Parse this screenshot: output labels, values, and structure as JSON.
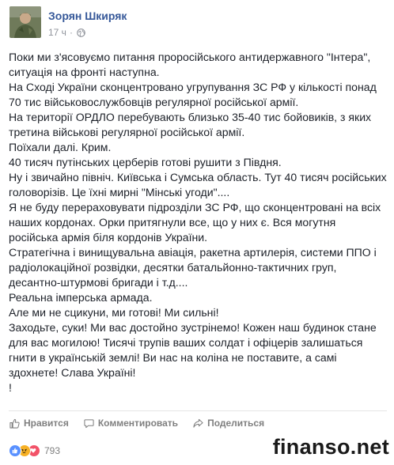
{
  "post": {
    "author": "Зорян Шкиряк",
    "time": "17 ч",
    "separator": "·",
    "paragraphs": [
      "Поки ми з'ясовуємо питання проросійського антидержавного \"Інтера\", ситуація на фронті наступна.",
      "На Сході України сконцентровано угрупування ЗС РФ у кількості понад 70 тис військовослужбовців регулярної російської армії.",
      "На території ОРДЛО перебувають близько 35-40 тис бойовиків, з яких третина військові регулярної російської армії.",
      "Поїхали далі. Крим.",
      "40 тисяч путінських церберів готові рушити з Півдня.",
      "Ну і звичайно північ. Київська і Сумська область. Тут 40 тисяч російських головорізів. Це їхні мирні \"Мінські угоди\"....",
      "Я не буду перераховувати підрозділи ЗС РФ, що сконцентровані на всіх наших кордонах. Орки притягнули все, що у них є. Вся могутня російська армія біля кордонів України.",
      "Стратегічна і винищувальна авіація, ракетна артилерія, системи ППО і радіолокаційної розвідки, десятки батальйонно-тактичних груп, десантно-штурмові бригади і т.д....",
      "Реальна імперська армада.",
      "Але ми не сцикуни, ми готові! Ми сильні!",
      "Заходьте, суки! Ми вас достойно зустрінемо! Кожен наш будинок стане для вас могилою! Тисячі трупів ваших солдат і офіцерів залишаться гнити в українській землі! Ви нас на коліна не поставите, а самі здохнете! Слава Україні!",
      "!"
    ]
  },
  "actions": {
    "like_label": "Нравится",
    "comment_label": "Комментировать",
    "share_label": "Поделиться"
  },
  "reactions": {
    "count": "793",
    "types": [
      "like",
      "angry",
      "love"
    ]
  },
  "watermark": "finanso.net",
  "icons": {
    "globe": "globe-icon",
    "like": "thumbs-up-icon",
    "comment": "comment-icon",
    "share": "share-icon"
  },
  "colors": {
    "author": "#365899",
    "meta": "#90949c",
    "text": "#1d2129",
    "like_reaction": "#5890ff",
    "angry_reaction": "#f7b125",
    "love_reaction": "#f25268"
  }
}
